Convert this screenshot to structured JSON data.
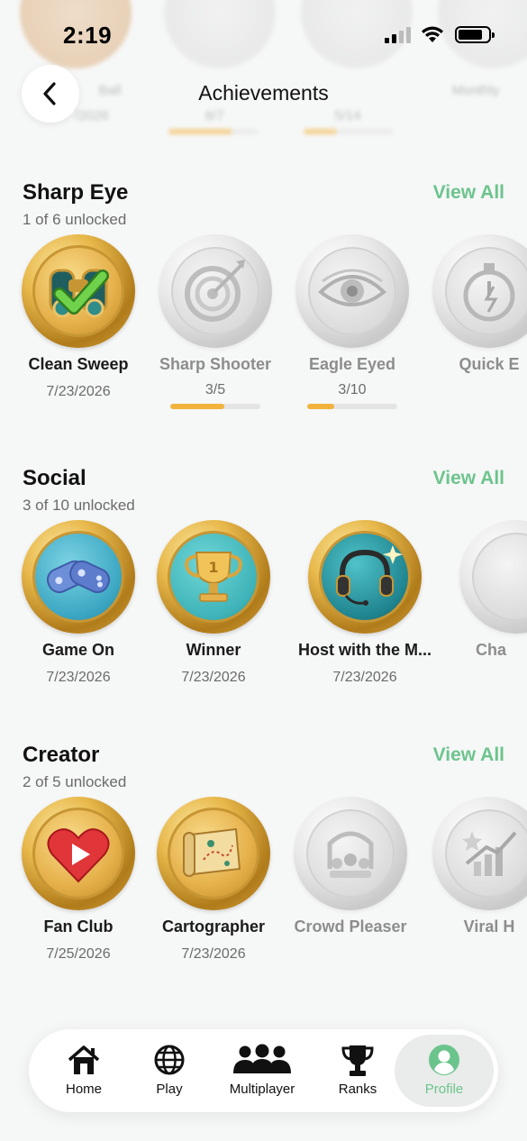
{
  "status": {
    "time": "2:19"
  },
  "header": {
    "title": "Achievements",
    "ghost": [
      {
        "name": "Ball",
        "sub": "/2026",
        "fill": 0
      },
      {
        "name": "",
        "sub": "6/7",
        "fill": 0.7
      },
      {
        "name": "",
        "sub": "5/14",
        "fill": 0.36
      },
      {
        "name": "Monthly",
        "sub": "",
        "fill": 0
      }
    ]
  },
  "sections": [
    {
      "title": "Sharp Eye",
      "subtitle": "1 of 6 unlocked",
      "view_all": "View All",
      "badges": [
        {
          "name": "Clean Sweep",
          "date": "7/23/2026",
          "unlocked": true,
          "icon": "binoculars-check-icon"
        },
        {
          "name": "Sharp Shooter",
          "progress": "3/5",
          "progress_fraction": 0.6,
          "unlocked": false,
          "icon": "target-arrow-icon"
        },
        {
          "name": "Eagle Eyed",
          "progress": "3/10",
          "progress_fraction": 0.3,
          "unlocked": false,
          "icon": "eye-icon"
        },
        {
          "name": "Quick E",
          "unlocked": false,
          "icon": "stopwatch-icon"
        }
      ]
    },
    {
      "title": "Social",
      "subtitle": "3 of 10 unlocked",
      "view_all": "View All",
      "badges": [
        {
          "name": "Game On",
          "date": "7/23/2026",
          "unlocked": true,
          "icon": "gamepads-icon"
        },
        {
          "name": "Winner",
          "date": "7/23/2026",
          "unlocked": true,
          "icon": "trophy-icon"
        },
        {
          "name": "Host with the M...",
          "date": "7/23/2026",
          "unlocked": true,
          "icon": "headset-icon"
        },
        {
          "name": "Cha",
          "unlocked": false,
          "icon": "locked-badge-icon"
        }
      ]
    },
    {
      "title": "Creator",
      "subtitle": "2 of 5 unlocked",
      "view_all": "View All",
      "badges": [
        {
          "name": "Fan Club",
          "date": "7/25/2026",
          "unlocked": true,
          "icon": "heart-play-icon"
        },
        {
          "name": "Cartographer",
          "date": "7/23/2026",
          "unlocked": true,
          "icon": "map-scroll-icon"
        },
        {
          "name": "Crowd Pleaser",
          "unlocked": false,
          "icon": "crowd-icon"
        },
        {
          "name": "Viral H",
          "unlocked": false,
          "icon": "viral-chart-icon"
        }
      ]
    }
  ],
  "nav": [
    {
      "label": "Home",
      "icon": "home-icon"
    },
    {
      "label": "Play",
      "icon": "globe-icon"
    },
    {
      "label": "Multiplayer",
      "icon": "group-icon"
    },
    {
      "label": "Ranks",
      "icon": "trophy-icon"
    },
    {
      "label": "Profile",
      "icon": "profile-icon",
      "active": true
    }
  ],
  "colors": {
    "accent": "#6cc48d",
    "progress": "#f2b33d",
    "gold": "#e5b04a"
  }
}
